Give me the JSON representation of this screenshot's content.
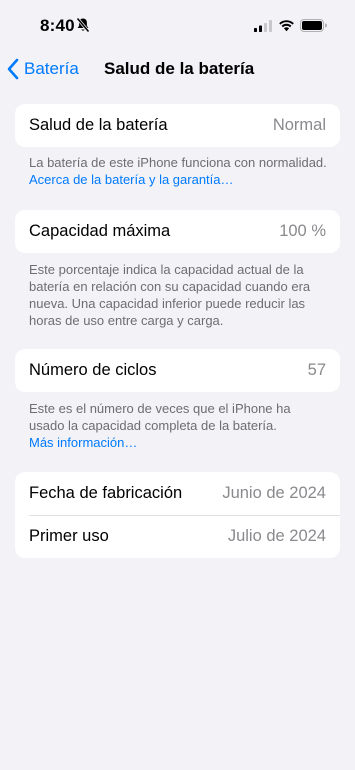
{
  "status_bar": {
    "time": "8:40"
  },
  "nav": {
    "back_label": "Batería",
    "title": "Salud de la batería"
  },
  "health": {
    "label": "Salud de la batería",
    "value": "Normal",
    "footnote_text": "La batería de este iPhone funciona con normalidad. ",
    "footnote_link": "Acerca de la batería y la garantía…"
  },
  "capacity": {
    "label": "Capacidad máxima",
    "value": "100 %",
    "footnote_text": "Este porcentaje indica la capacidad actual de la batería en relación con su capacidad cuando era nueva. Una capacidad inferior puede reducir las horas de uso entre carga y carga."
  },
  "cycles": {
    "label": "Número de ciclos",
    "value": "57",
    "footnote_text": "Este es el número de veces que el iPhone ha usado la capacidad completa de la batería.",
    "footnote_link": "Más información…"
  },
  "dates": {
    "manufacture_label": "Fecha de fabricación",
    "manufacture_value": "Junio de 2024",
    "first_use_label": "Primer uso",
    "first_use_value": "Julio de 2024"
  },
  "colors": {
    "accent": "#007aff",
    "background": "#f2f2f7",
    "secondary_text": "#8a8a8e"
  }
}
